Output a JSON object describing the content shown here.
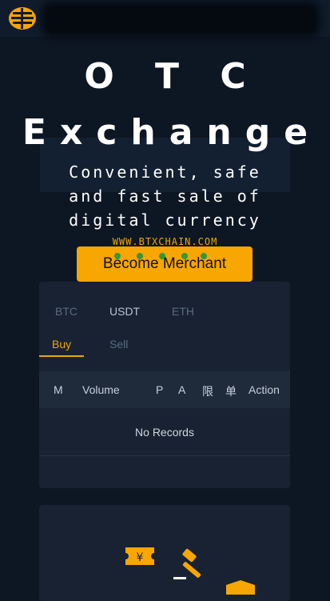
{
  "hero": {
    "title_line1": "O T C",
    "title_line2": "Exchange",
    "subtitle_lines": [
      "Convenient, safe",
      "and fast sale of",
      "digital currency"
    ],
    "site": "WWW.BTXCHAIN.COM"
  },
  "cta": {
    "label": "Become Merchant"
  },
  "market": {
    "coin_tabs": [
      "BTC",
      "USDT",
      "ETH"
    ],
    "active_coin": "USDT",
    "side_tabs": [
      "Buy",
      "Sell"
    ],
    "active_side": "Buy",
    "columns": [
      "M",
      "Volume",
      "P",
      "A",
      "限",
      "单",
      "Action"
    ],
    "empty_text": "No Records"
  },
  "colors": {
    "accent": "#f7a602",
    "background": "#0d1623",
    "card": "#182232"
  }
}
